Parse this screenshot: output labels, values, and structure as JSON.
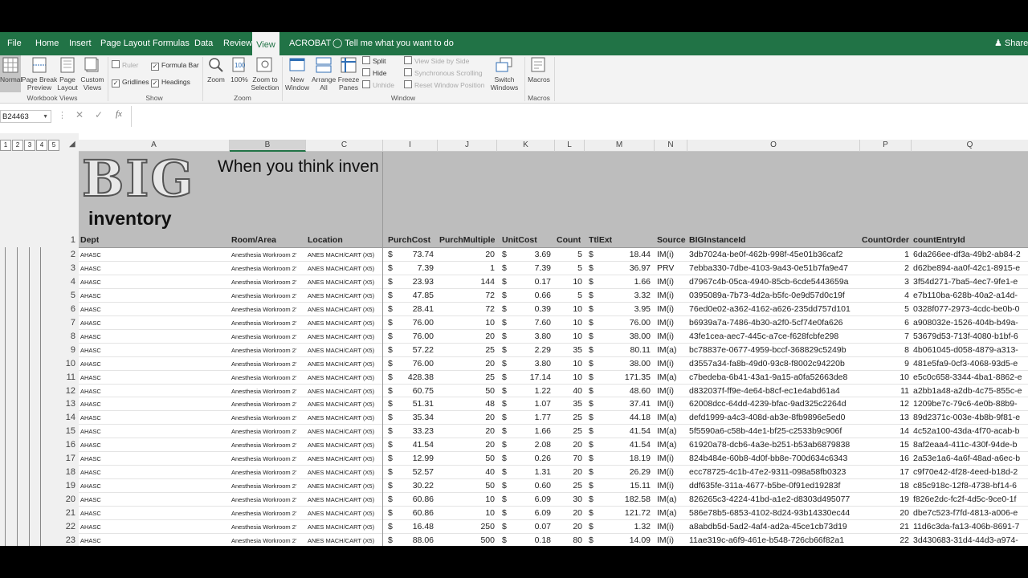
{
  "tabs": [
    "File",
    "Home",
    "Insert",
    "Page Layout",
    "Formulas",
    "Data",
    "Review",
    "View",
    "ACROBAT"
  ],
  "active_tab": "View",
  "tell_me": "Tell me what you want to do",
  "share": "Share",
  "ribbon": {
    "workbook_views": {
      "label": "Workbook Views",
      "normal": "Normal",
      "page_break": "Page Break\nPreview",
      "page_layout": "Page\nLayout",
      "custom": "Custom\nViews"
    },
    "show": {
      "label": "Show",
      "ruler": "Ruler",
      "formula_bar": "Formula Bar",
      "gridlines": "Gridlines",
      "headings": "Headings"
    },
    "zoom": {
      "label": "Zoom",
      "zoom": "Zoom",
      "hundred": "100%",
      "selection": "Zoom to\nSelection"
    },
    "window": {
      "label": "Window",
      "new_window": "New\nWindow",
      "arrange": "Arrange\nAll",
      "freeze": "Freeze\nPanes",
      "split": "Split",
      "hide": "Hide",
      "unhide": "Unhide",
      "side_by_side": "View Side by Side",
      "sync": "Synchronous Scrolling",
      "reset": "Reset Window Position",
      "switch": "Switch\nWindows"
    },
    "macros": {
      "label": "Macros",
      "macros": "Macros"
    }
  },
  "name_box": "B24463",
  "outline_levels": [
    "1",
    "2",
    "3",
    "4",
    "5"
  ],
  "columns": [
    "A",
    "B",
    "C",
    "I",
    "J",
    "K",
    "L",
    "M",
    "N",
    "O",
    "P",
    "Q"
  ],
  "banner": {
    "logo_big": "BIG",
    "logo_sub": "inventory",
    "tagline": "When you think inven"
  },
  "headers": [
    "Dept",
    "Room/Area",
    "Location",
    "PurchCost",
    "PurchMultiple",
    "UnitCost",
    "Count",
    "TtlExt",
    "Source",
    "BIGInstanceId",
    "CountOrder",
    "countEntryId"
  ],
  "currency": "$",
  "rows": [
    [
      "2",
      "AHASC",
      "Anesthesia Workroom 2’",
      "ANES MACH/CART (X5)",
      "73.74",
      "20",
      "3.69",
      "5",
      "18.44",
      "IM(i)",
      "3db7024a-be0f-462b-998f-45e01b36caf2",
      "1",
      "6da266ee-df3a-49b2-ab84-2"
    ],
    [
      "3",
      "AHASC",
      "Anesthesia Workroom 2’",
      "ANES MACH/CART (X5)",
      "7.39",
      "1",
      "7.39",
      "5",
      "36.97",
      "PRV",
      "7ebba330-7dbe-4103-9a43-0e51b7fa9e47",
      "2",
      "d62be894-aa0f-42c1-8915-e"
    ],
    [
      "4",
      "AHASC",
      "Anesthesia Workroom 2’",
      "ANES MACH/CART (X5)",
      "23.93",
      "144",
      "0.17",
      "10",
      "1.66",
      "IM(i)",
      "d7967c4b-05ca-4940-85cb-6cde5443659a",
      "3",
      "3f54d271-7ba5-4ec7-9fe1-e"
    ],
    [
      "5",
      "AHASC",
      "Anesthesia Workroom 2’",
      "ANES MACH/CART (X5)",
      "47.85",
      "72",
      "0.66",
      "5",
      "3.32",
      "IM(i)",
      "0395089a-7b73-4d2a-b5fc-0e9d57d0c19f",
      "4",
      "e7b110ba-628b-40a2-a14d-"
    ],
    [
      "6",
      "AHASC",
      "Anesthesia Workroom 2’",
      "ANES MACH/CART (X5)",
      "28.41",
      "72",
      "0.39",
      "10",
      "3.95",
      "IM(i)",
      "76ed0e02-a362-4162-a626-235dd757d101",
      "5",
      "0328f077-2973-4cdc-be0b-0"
    ],
    [
      "7",
      "AHASC",
      "Anesthesia Workroom 2’",
      "ANES MACH/CART (X5)",
      "76.00",
      "10",
      "7.60",
      "10",
      "76.00",
      "IM(i)",
      "b6939a7a-7486-4b30-a2f0-5cf74e0fa626",
      "6",
      "a908032e-1526-404b-b49a-"
    ],
    [
      "8",
      "AHASC",
      "Anesthesia Workroom 2’",
      "ANES MACH/CART (X5)",
      "76.00",
      "20",
      "3.80",
      "10",
      "38.00",
      "IM(i)",
      "43fe1cea-aec7-445c-a7ce-f628fcbfe298",
      "7",
      "53679d53-713f-4080-b1bf-6"
    ],
    [
      "9",
      "AHASC",
      "Anesthesia Workroom 2’",
      "ANES MACH/CART (X5)",
      "57.22",
      "25",
      "2.29",
      "35",
      "80.11",
      "IM(a)",
      "bc78837e-0677-4959-bccf-368829c5249b",
      "8",
      "4b061045-d058-4879-a313-"
    ],
    [
      "10",
      "AHASC",
      "Anesthesia Workroom 2’",
      "ANES MACH/CART (X5)",
      "76.00",
      "20",
      "3.80",
      "10",
      "38.00",
      "IM(i)",
      "d3557a34-fa8b-49d0-93c8-f8002c94220b",
      "9",
      "481e5fa9-0cf3-4068-93d5-e"
    ],
    [
      "11",
      "AHASC",
      "Anesthesia Workroom 2’",
      "ANES MACH/CART (X5)",
      "428.38",
      "25",
      "17.14",
      "10",
      "171.35",
      "IM(a)",
      "c7bedeba-6b41-43a1-9a15-a0fa52663de8",
      "10",
      "e5c0c658-3344-4ba1-8862-e"
    ],
    [
      "12",
      "AHASC",
      "Anesthesia Workroom 2’",
      "ANES MACH/CART (X5)",
      "60.75",
      "50",
      "1.22",
      "40",
      "48.60",
      "IM(i)",
      "d832037f-ff9e-4e64-b8cf-ec1e4abd61a4",
      "11",
      "a2bb1a48-a2db-4c75-855c-e"
    ],
    [
      "13",
      "AHASC",
      "Anesthesia Workroom 2’",
      "ANES MACH/CART (X5)",
      "51.31",
      "48",
      "1.07",
      "35",
      "37.41",
      "IM(i)",
      "62008dcc-64dd-4239-bfac-9ad325c2264d",
      "12",
      "1209be7c-79c6-4e0b-88b9-"
    ],
    [
      "14",
      "AHASC",
      "Anesthesia Workroom 2’",
      "ANES MACH/CART (X5)",
      "35.34",
      "20",
      "1.77",
      "25",
      "44.18",
      "IM(a)",
      "defd1999-a4c3-408d-ab3e-8fb9896e5ed0",
      "13",
      "89d2371c-003e-4b8b-9f81-e"
    ],
    [
      "15",
      "AHASC",
      "Anesthesia Workroom 2’",
      "ANES MACH/CART (X5)",
      "33.23",
      "20",
      "1.66",
      "25",
      "41.54",
      "IM(a)",
      "5f5590a6-c58b-44e1-bf25-c2533b9c906f",
      "14",
      "4c52a100-43da-4f70-acab-b"
    ],
    [
      "16",
      "AHASC",
      "Anesthesia Workroom 2’",
      "ANES MACH/CART (X5)",
      "41.54",
      "20",
      "2.08",
      "20",
      "41.54",
      "IM(a)",
      "61920a78-dcb6-4a3e-b251-b53ab6879838",
      "15",
      "8af2eaa4-411c-430f-94de-b"
    ],
    [
      "17",
      "AHASC",
      "Anesthesia Workroom 2’",
      "ANES MACH/CART (X5)",
      "12.99",
      "50",
      "0.26",
      "70",
      "18.19",
      "IM(i)",
      "824b484e-60b8-4d0f-bb8e-700d634c6343",
      "16",
      "2a53e1a6-4a6f-48ad-a6ec-b"
    ],
    [
      "18",
      "AHASC",
      "Anesthesia Workroom 2’",
      "ANES MACH/CART (X5)",
      "52.57",
      "40",
      "1.31",
      "20",
      "26.29",
      "IM(i)",
      "ecc78725-4c1b-47e2-9311-098a58fb0323",
      "17",
      "c9f70e42-4f28-4eed-b18d-2"
    ],
    [
      "19",
      "AHASC",
      "Anesthesia Workroom 2’",
      "ANES MACH/CART (X5)",
      "30.22",
      "50",
      "0.60",
      "25",
      "15.11",
      "IM(i)",
      "ddf635fe-311a-4677-b5be-0f91ed19283f",
      "18",
      "c85c918c-12f8-4738-bf14-6"
    ],
    [
      "20",
      "AHASC",
      "Anesthesia Workroom 2’",
      "ANES MACH/CART (X5)",
      "60.86",
      "10",
      "6.09",
      "30",
      "182.58",
      "IM(a)",
      "826265c3-4224-41bd-a1e2-d8303d495077",
      "19",
      "f826e2dc-fc2f-4d5c-9ce0-1f"
    ],
    [
      "21",
      "AHASC",
      "Anesthesia Workroom 2’",
      "ANES MACH/CART (X5)",
      "60.86",
      "10",
      "6.09",
      "20",
      "121.72",
      "IM(a)",
      "586e78b5-6853-4102-8d24-93b14330ec44",
      "20",
      "dbe7c523-f7fd-4813-a006-e"
    ],
    [
      "22",
      "AHASC",
      "Anesthesia Workroom 2’",
      "ANES MACH/CART (X5)",
      "16.48",
      "250",
      "0.07",
      "20",
      "1.32",
      "IM(i)",
      "a8abdb5d-5ad2-4af4-ad2a-45ce1cb73d19",
      "21",
      "11d6c3da-fa13-406b-8691-7"
    ],
    [
      "23",
      "AHASC",
      "Anesthesia Workroom 2’",
      "ANES MACH/CART (X5)",
      "88.06",
      "500",
      "0.18",
      "80",
      "14.09",
      "IM(i)",
      "11ae319c-a6f9-461e-b548-726cb66f82a1",
      "22",
      "3d430683-31d4-44d3-a974-"
    ]
  ]
}
